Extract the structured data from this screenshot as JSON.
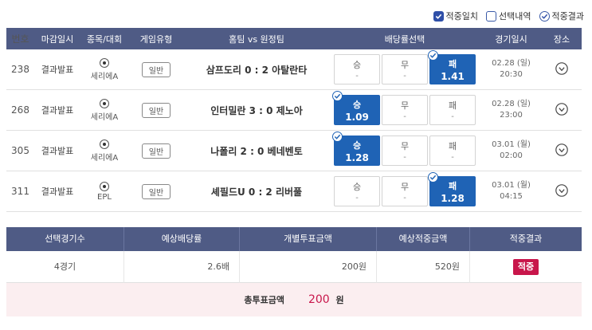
{
  "legend": {
    "match_label": "적중일치",
    "selection_label": "선택내역",
    "result_label": "적중결과"
  },
  "games_header": {
    "no": "번호",
    "close": "마감일시",
    "league": "종목/대회",
    "type": "게임유형",
    "match": "홈팀 vs 원정팀",
    "odds": "배당률선택",
    "date": "경기일시",
    "place": "장소"
  },
  "games": [
    {
      "no": "238",
      "status": "결과발표",
      "league": "세리에A",
      "type": "일반",
      "match": "삼프도리 0 : 2 아탈란타",
      "odds": [
        {
          "label": "승",
          "value": "-"
        },
        {
          "label": "무",
          "value": "-"
        },
        {
          "label": "패",
          "value": "1.41"
        }
      ],
      "selected": 2,
      "date": "02.28 (일)",
      "time": "20:30"
    },
    {
      "no": "268",
      "status": "결과발표",
      "league": "세리에A",
      "type": "일반",
      "match": "인터밀란 3 : 0 제노아",
      "odds": [
        {
          "label": "승",
          "value": "1.09"
        },
        {
          "label": "무",
          "value": "-"
        },
        {
          "label": "패",
          "value": "-"
        }
      ],
      "selected": 0,
      "date": "02.28 (일)",
      "time": "23:00"
    },
    {
      "no": "305",
      "status": "결과발표",
      "league": "세리에A",
      "type": "일반",
      "match": "나폴리 2 : 0 베네벤토",
      "odds": [
        {
          "label": "승",
          "value": "1.28"
        },
        {
          "label": "무",
          "value": "-"
        },
        {
          "label": "패",
          "value": "-"
        }
      ],
      "selected": 0,
      "date": "03.01 (월)",
      "time": "02:00"
    },
    {
      "no": "311",
      "status": "결과발표",
      "league": "EPL",
      "type": "일반",
      "match": "셰필드U 0 : 2 리버풀",
      "odds": [
        {
          "label": "승",
          "value": "-"
        },
        {
          "label": "무",
          "value": "-"
        },
        {
          "label": "패",
          "value": "1.28"
        }
      ],
      "selected": 2,
      "date": "03.01 (월)",
      "time": "04:15"
    }
  ],
  "summary_header": {
    "count": "선택경기수",
    "odds": "예상배당률",
    "stake": "개별투표금액",
    "payout": "예상적중금액",
    "result": "적중결과"
  },
  "summary": {
    "count": "4경기",
    "odds": "2.6배",
    "stake": "200원",
    "payout": "520원",
    "result": "적중"
  },
  "total": {
    "label": "총투표금액",
    "amount": "200",
    "unit": "원"
  },
  "colors": {
    "header_bg": "#4f5b85",
    "selected_odd": "#1f63b5",
    "hit_badge": "#c8164b",
    "total_bg": "#fbeef0"
  }
}
